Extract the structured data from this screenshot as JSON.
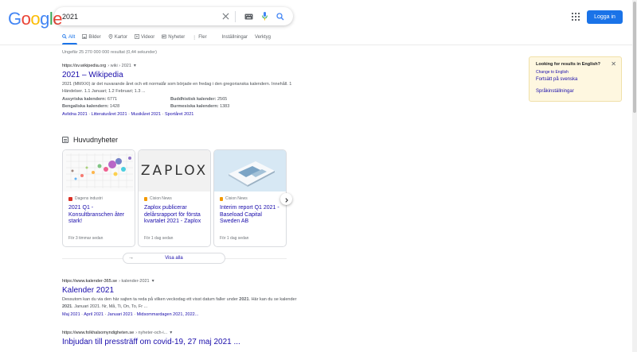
{
  "logo": "Google",
  "search": {
    "query": "2021"
  },
  "header": {
    "login_label": "Logga in"
  },
  "tabs": [
    {
      "icon": "search-icon",
      "label": "Allt"
    },
    {
      "icon": "image-icon",
      "label": "Bilder"
    },
    {
      "icon": "map-icon",
      "label": "Kartor"
    },
    {
      "icon": "video-icon",
      "label": "Videor"
    },
    {
      "icon": "news-icon",
      "label": "Nyheter"
    },
    {
      "icon": "more-icon",
      "label": "Fler"
    },
    {
      "icon": "",
      "label": "Inställningar"
    },
    {
      "icon": "",
      "label": "Verktyg"
    }
  ],
  "stats": "Ungefär 25 270 000 000 resultat (0,44 sekunder)",
  "results": [
    {
      "url": "https://sv.wikipedia.org",
      "path": "› wiki › 2021",
      "title": "2021 – Wikipedia",
      "snippet": "2021 (MMXXI) är det nuvarande året och ett normalår som började en fredag i den gregorianska kalendern. Innehåll. 1 Händelser. 1.1 Januari; 1.2 Februari; 1.3 ...",
      "facts": [
        {
          "label": "Assyriska kalendern:",
          "value": "6771"
        },
        {
          "label": "Buddhistisk kalender:",
          "value": "2565"
        },
        {
          "label": "Bengaliska kalendern:",
          "value": "1428"
        },
        {
          "label": "Burmesiska kalendern:",
          "value": "1383"
        }
      ],
      "sitelinks": [
        "Avlidna 2021",
        "Litteraturåret 2021",
        "Musikåret 2021",
        "Sportåret 2021"
      ]
    },
    {
      "url": "https://www.kalender-365.se",
      "path": "› kalender-2021",
      "title": "Kalender 2021",
      "snippet_pre": "Dessutom kan du via den här sajten ta reda på vilken veckodag ett visst datum faller under ",
      "snippet_b1": "2021",
      "snippet_mid": ". Här kan du se kalender ",
      "snippet_b2": "2021",
      "snippet_post": ". Januari 2021. Nr, Må, Ti, On, To, Fr ...",
      "sitelinks": [
        "Maj 2021",
        "April 2021",
        "Januari 2021",
        "Midsommardagen 2021, 2022..."
      ]
    },
    {
      "url": "https://www.folkhalsomyndigheten.se",
      "path": "› nyheter-och-i...",
      "title": "Inbjudan till pressträff om covid-19, 27 maj 2021 ..."
    }
  ],
  "top_stories": {
    "heading": "Huvudnyheter",
    "view_all": "Visa alla",
    "cards": [
      {
        "source": "Dagens industri",
        "title": "2021 Q1 - Konsultbranschen åter stark!",
        "time": "För 3 timmar sedan",
        "fav_color": "#d93025"
      },
      {
        "source": "Cision News",
        "title": "Zaplox publicerar delårsrapport för första kvartalet 2021 - Zaplox",
        "time": "För 1 dag sedan",
        "fav_color": "#f29900"
      },
      {
        "source": "Cision News",
        "title": "Interim report Q1 2021 - Baseload Capital Sweden AB",
        "time": "För 1 dag sedan",
        "fav_color": "#f29900"
      }
    ],
    "zaplox_text": "ZAPLOX"
  },
  "notice": {
    "question": "Looking for results in English?",
    "change": "Change to English",
    "continue": "Fortsätt på svenska",
    "settings": "Språkinställningar"
  },
  "colors": {
    "link": "#1a0dab",
    "accent": "#1a73e8",
    "notice_bg": "#fef7e0"
  }
}
